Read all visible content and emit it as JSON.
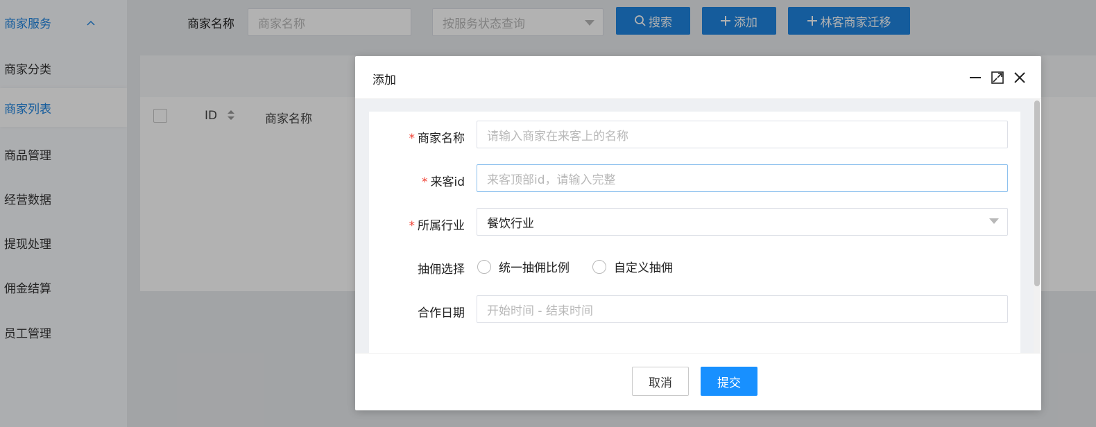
{
  "sidebar": {
    "group_label": "商家服务",
    "items": [
      {
        "label": "商家分类"
      },
      {
        "label": "商家列表"
      },
      {
        "label": "商品管理"
      },
      {
        "label": "经营数据"
      },
      {
        "label": "提现处理"
      },
      {
        "label": "佣金结算"
      },
      {
        "label": "员工管理"
      }
    ]
  },
  "search": {
    "name_label": "商家名称",
    "name_placeholder": "商家名称",
    "status_placeholder": "按服务状态查询",
    "search_button": "搜索",
    "add_button": "添加",
    "migrate_button": "林客商家迁移"
  },
  "table": {
    "headers": [
      "ID",
      "商家名称"
    ]
  },
  "modal": {
    "title": "添加",
    "fields": {
      "merchant_name": {
        "label": "商家名称",
        "placeholder": "请输入商家在来客上的名称"
      },
      "laike_id": {
        "label": "来客id",
        "placeholder": "来客顶部id，请输入完整"
      },
      "industry": {
        "label": "所属行业",
        "value": "餐饮行业"
      },
      "commission": {
        "label": "抽佣选择",
        "options": [
          "统一抽佣比例",
          "自定义抽佣"
        ]
      },
      "coop_date": {
        "label": "合作日期",
        "placeholder": "开始时间 - 结束时间"
      }
    },
    "cancel_button": "取消",
    "submit_button": "提交"
  },
  "colors": {
    "primary": "#1f85e0",
    "submit": "#1890ff",
    "required": "#f04134"
  }
}
